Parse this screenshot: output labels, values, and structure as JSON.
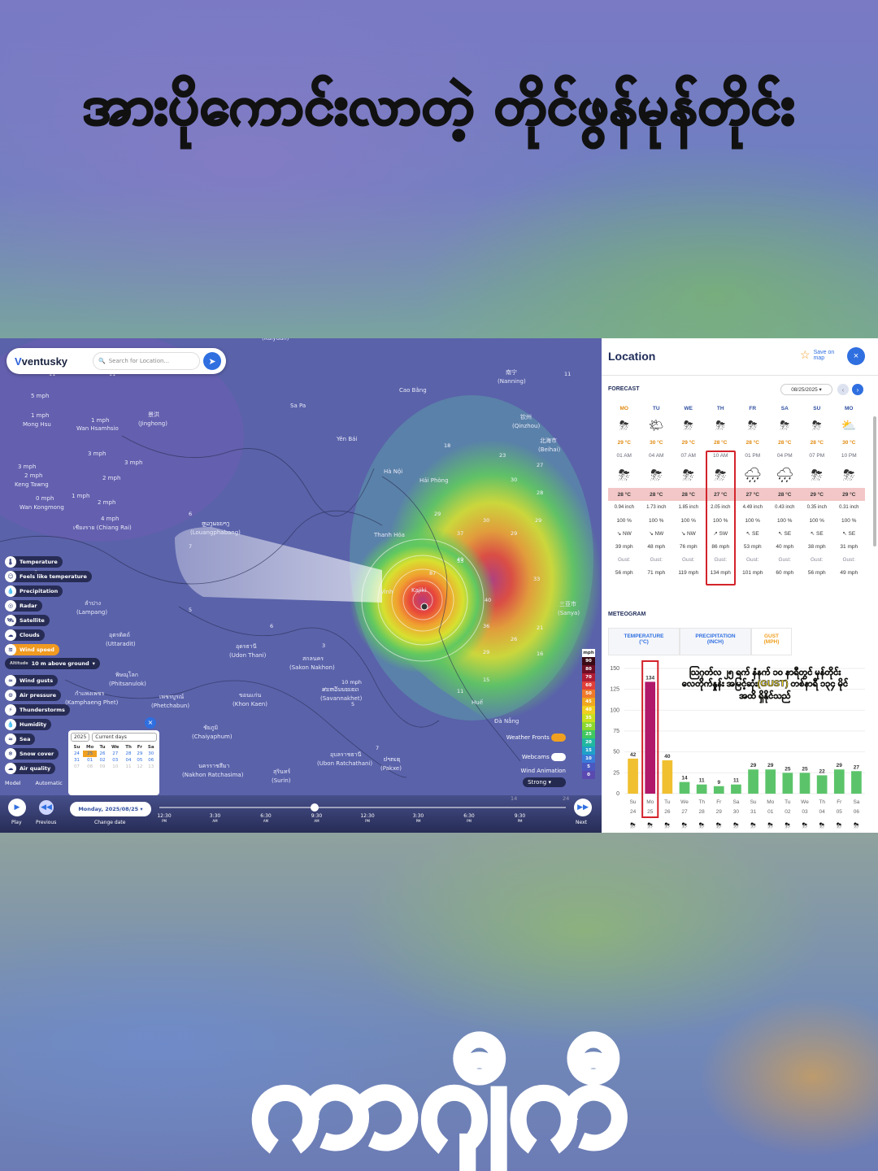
{
  "overlay": {
    "title": "အားပိုကောင်းလာတဲ့ တိုင်ဖွန်မုန်တိုင်း",
    "bottom_word": "ကာဂျီကီ"
  },
  "app": {
    "logo": "ventusky",
    "search_placeholder": "Search for Location..."
  },
  "map_labels": [
    {
      "text": "5 mph",
      "x": 38,
      "y": 73
    },
    {
      "text": "1 mph",
      "x": 38,
      "y": 97
    },
    {
      "text": "Mong Hsu",
      "x": 28,
      "y": 108
    },
    {
      "text": "1 mph",
      "x": 112,
      "y": 103
    },
    {
      "text": "Wan Hsamhsio",
      "x": 94,
      "y": 113
    },
    {
      "text": "景洪",
      "x": 182,
      "y": 96
    },
    {
      "text": "(Jinghong)",
      "x": 170,
      "y": 107
    },
    {
      "text": "3 mph",
      "x": 108,
      "y": 144
    },
    {
      "text": "3 mph",
      "x": 153,
      "y": 155
    },
    {
      "text": "3 mph",
      "x": 22,
      "y": 160
    },
    {
      "text": "2 mph",
      "x": 30,
      "y": 171
    },
    {
      "text": "Keng Tawng",
      "x": 18,
      "y": 182
    },
    {
      "text": "2 mph",
      "x": 126,
      "y": 174
    },
    {
      "text": "2 mph",
      "x": 120,
      "y": 204
    },
    {
      "text": "1 mph",
      "x": 88,
      "y": 196
    },
    {
      "text": "0 mph",
      "x": 44,
      "y": 199
    },
    {
      "text": "Wan Kongmong",
      "x": 24,
      "y": 210
    },
    {
      "text": "4 mph",
      "x": 124,
      "y": 224
    },
    {
      "text": "เชียงราย (Chiang Rai)",
      "x": 90,
      "y": 235
    },
    {
      "text": "ຫຼວງພະບາງ",
      "x": 248,
      "y": 230
    },
    {
      "text": "(Louangphabang)",
      "x": 234,
      "y": 241
    },
    {
      "text": "Sa Pa",
      "x": 357,
      "y": 85
    },
    {
      "text": "Yên Bái",
      "x": 414,
      "y": 126
    },
    {
      "text": "Cao Bằng",
      "x": 491,
      "y": 66
    },
    {
      "text": "南宁",
      "x": 622,
      "y": 44
    },
    {
      "text": "(Nanning)",
      "x": 612,
      "y": 55
    },
    {
      "text": "钦州",
      "x": 640,
      "y": 99
    },
    {
      "text": "(Qinzhou)",
      "x": 630,
      "y": 110
    },
    {
      "text": "北海市",
      "x": 664,
      "y": 128
    },
    {
      "text": "(Beihai)",
      "x": 662,
      "y": 139
    },
    {
      "text": "Hà Nội",
      "x": 472,
      "y": 166
    },
    {
      "text": "Hải Phòng",
      "x": 516,
      "y": 177
    },
    {
      "text": "Thanh Hóa",
      "x": 460,
      "y": 244
    },
    {
      "text": "Vinh",
      "x": 468,
      "y": 314
    },
    {
      "text": "Kajiki",
      "x": 506,
      "y": 312
    },
    {
      "text": "ลำปาง",
      "x": 104,
      "y": 328
    },
    {
      "text": "(Lampang)",
      "x": 94,
      "y": 339
    },
    {
      "text": "อุตรดิตถ์",
      "x": 134,
      "y": 367
    },
    {
      "text": "(Uttaradit)",
      "x": 130,
      "y": 378
    },
    {
      "text": "อุดรธานี",
      "x": 290,
      "y": 381
    },
    {
      "text": "(Udon Thani)",
      "x": 282,
      "y": 392
    },
    {
      "text": "สกลนคร",
      "x": 372,
      "y": 396
    },
    {
      "text": "(Sakon Nakhon)",
      "x": 356,
      "y": 407
    },
    {
      "text": "พิษณุโลก",
      "x": 142,
      "y": 416
    },
    {
      "text": "(Phitsanulok)",
      "x": 134,
      "y": 427
    },
    {
      "text": "กำแพงเพชร",
      "x": 92,
      "y": 439
    },
    {
      "text": "(Kamphaeng Phet)",
      "x": 80,
      "y": 450
    },
    {
      "text": "เพชรบูรณ์",
      "x": 196,
      "y": 443
    },
    {
      "text": "(Phetchabun)",
      "x": 186,
      "y": 454
    },
    {
      "text": "ขอนแก่น",
      "x": 294,
      "y": 441
    },
    {
      "text": "(Khon Kaen)",
      "x": 286,
      "y": 452
    },
    {
      "text": "ສະຫວັນນະເຂດ",
      "x": 396,
      "y": 434
    },
    {
      "text": "(Savannakhet)",
      "x": 394,
      "y": 445
    },
    {
      "text": "Huế",
      "x": 580,
      "y": 450
    },
    {
      "text": "Đà Nẵng",
      "x": 608,
      "y": 473
    },
    {
      "text": "ชัยภูมิ",
      "x": 250,
      "y": 481
    },
    {
      "text": "(Chaiyaphum)",
      "x": 236,
      "y": 492
    },
    {
      "text": "อุบลราชธานี",
      "x": 406,
      "y": 514
    },
    {
      "text": "(Ubon Ratchathani)",
      "x": 390,
      "y": 525
    },
    {
      "text": "ປາກເຊ",
      "x": 472,
      "y": 520
    },
    {
      "text": "(Pakxe)",
      "x": 468,
      "y": 531
    },
    {
      "text": "นครราชสีมา",
      "x": 244,
      "y": 528
    },
    {
      "text": "(Nakhon Ratchasima)",
      "x": 224,
      "y": 539
    },
    {
      "text": "สุรินทร์",
      "x": 336,
      "y": 535
    },
    {
      "text": "(Surin)",
      "x": 334,
      "y": 546
    },
    {
      "text": "三亚市",
      "x": 688,
      "y": 329
    },
    {
      "text": "(Sanya)",
      "x": 686,
      "y": 340
    },
    {
      "text": "(Kalyuan)",
      "x": 322,
      "y": 2
    }
  ],
  "map_numbers": [
    {
      "t": "11",
      "x": 60,
      "y": 46
    },
    {
      "t": "11",
      "x": 134,
      "y": 46
    },
    {
      "t": "11",
      "x": 694,
      "y": 46
    },
    {
      "t": "18",
      "x": 546,
      "y": 134
    },
    {
      "t": "23",
      "x": 614,
      "y": 146
    },
    {
      "t": "27",
      "x": 660,
      "y": 158
    },
    {
      "t": "30",
      "x": 628,
      "y": 176
    },
    {
      "t": "28",
      "x": 660,
      "y": 192
    },
    {
      "t": "29",
      "x": 534,
      "y": 218
    },
    {
      "t": "30",
      "x": 594,
      "y": 226
    },
    {
      "t": "29",
      "x": 658,
      "y": 226
    },
    {
      "t": "37",
      "x": 562,
      "y": 242
    },
    {
      "t": "29",
      "x": 628,
      "y": 242
    },
    {
      "t": "53",
      "x": 562,
      "y": 276
    },
    {
      "t": "49",
      "x": 562,
      "y": 274
    },
    {
      "t": "87",
      "x": 528,
      "y": 291
    },
    {
      "t": "40",
      "x": 596,
      "y": 324
    },
    {
      "t": "33",
      "x": 656,
      "y": 298
    },
    {
      "t": "36",
      "x": 594,
      "y": 356
    },
    {
      "t": "29",
      "x": 594,
      "y": 388
    },
    {
      "t": "26",
      "x": 628,
      "y": 372
    },
    {
      "t": "21",
      "x": 660,
      "y": 358
    },
    {
      "t": "16",
      "x": 660,
      "y": 390
    },
    {
      "t": "15",
      "x": 594,
      "y": 422
    },
    {
      "t": "11",
      "x": 562,
      "y": 436
    },
    {
      "t": "10 mph",
      "x": 420,
      "y": 425
    },
    {
      "t": "8",
      "x": 42,
      "y": 290
    },
    {
      "t": "6",
      "x": 232,
      "y": 218
    },
    {
      "t": "7",
      "x": 232,
      "y": 258
    },
    {
      "t": "5",
      "x": 232,
      "y": 336
    },
    {
      "t": "6",
      "x": 332,
      "y": 356
    },
    {
      "t": "3",
      "x": 396,
      "y": 380
    },
    {
      "t": "5",
      "x": 432,
      "y": 452
    },
    {
      "t": "7",
      "x": 462,
      "y": 506
    },
    {
      "t": "14",
      "x": 628,
      "y": 568
    },
    {
      "t": "24",
      "x": 692,
      "y": 568
    }
  ],
  "layers": [
    {
      "label": "Temperature",
      "icon": "thermometer-icon",
      "glyph": "🌡",
      "active": false
    },
    {
      "label": "Feels like temperature",
      "icon": "feels-like-icon",
      "glyph": "☺",
      "active": false
    },
    {
      "label": "Precipitation",
      "icon": "raindrop-icon",
      "glyph": "💧",
      "active": false
    },
    {
      "label": "Radar",
      "icon": "radar-icon",
      "glyph": "◎",
      "active": false
    },
    {
      "label": "Satellite",
      "icon": "satellite-icon",
      "glyph": "🛰",
      "active": false
    },
    {
      "label": "Clouds",
      "icon": "cloud-icon",
      "glyph": "☁",
      "active": false
    },
    {
      "label": "Wind speed",
      "icon": "wind-icon",
      "glyph": "≋",
      "active": true
    },
    {
      "label": "Wind gusts",
      "icon": "wind-gust-icon",
      "glyph": "≈",
      "active": false
    },
    {
      "label": "Air pressure",
      "icon": "pressure-icon",
      "glyph": "⊙",
      "active": false
    },
    {
      "label": "Thunderstorms",
      "icon": "lightning-icon",
      "glyph": "⚡",
      "active": false
    },
    {
      "label": "Humidity",
      "icon": "humidity-icon",
      "glyph": "💧",
      "active": false
    },
    {
      "label": "Sea",
      "icon": "wave-icon",
      "glyph": "≈",
      "active": false
    },
    {
      "label": "Snow cover",
      "icon": "snowflake-icon",
      "glyph": "❄",
      "active": false
    },
    {
      "label": "Air quality",
      "icon": "air-quality-icon",
      "glyph": "☁",
      "active": false
    }
  ],
  "altitude": {
    "label": "Altitude",
    "value": "10 m above ground"
  },
  "model": {
    "label": "Model",
    "value": "Automatic"
  },
  "calendar": {
    "year": "2025",
    "mode": "Current days",
    "weekdays": [
      "Su",
      "Mo",
      "Tu",
      "We",
      "Th",
      "Fr",
      "Sa"
    ],
    "weeks": [
      [
        "24",
        "25",
        "26",
        "27",
        "28",
        "29",
        "30"
      ],
      [
        "31",
        "01",
        "02",
        "03",
        "04",
        "05",
        "06"
      ],
      [
        "07",
        "08",
        "09",
        "10",
        "11",
        "12",
        "13"
      ]
    ],
    "today": "25"
  },
  "timeline": {
    "date": "Monday, 2025/08/25",
    "change_date": "Change date",
    "play": "Play",
    "previous": "Previous",
    "next": "Next",
    "ticks": [
      {
        "t": "12:30",
        "p": "PM"
      },
      {
        "t": "3:30",
        "p": "AM"
      },
      {
        "t": "6:30",
        "p": "AM"
      },
      {
        "t": "9:30",
        "p": "AM"
      },
      {
        "t": "12:30",
        "p": "PM"
      },
      {
        "t": "3:30",
        "p": "PM"
      },
      {
        "t": "6:30",
        "p": "PM"
      },
      {
        "t": "9:30",
        "p": "PM"
      }
    ]
  },
  "wind_legend": {
    "unit": "mph",
    "steps": [
      {
        "v": "90",
        "c": "#3a0a14"
      },
      {
        "v": "80",
        "c": "#6e0e24"
      },
      {
        "v": "70",
        "c": "#b01c34"
      },
      {
        "v": "60",
        "c": "#e0403a"
      },
      {
        "v": "50",
        "c": "#f07a2a"
      },
      {
        "v": "45",
        "c": "#f0a820"
      },
      {
        "v": "40",
        "c": "#f0d020"
      },
      {
        "v": "35",
        "c": "#c8e020"
      },
      {
        "v": "30",
        "c": "#8cd830"
      },
      {
        "v": "25",
        "c": "#40c860"
      },
      {
        "v": "20",
        "c": "#20b8a0"
      },
      {
        "v": "15",
        "c": "#20a0c8"
      },
      {
        "v": "10",
        "c": "#3a7ad8"
      },
      {
        "v": "5",
        "c": "#4a58c0"
      },
      {
        "v": "0",
        "c": "#5a4ab0"
      }
    ]
  },
  "map_controls": {
    "weather_fronts": "Weather Fronts",
    "webcams": "Webcams",
    "wind_animation": "Wind Animation",
    "wind_animation_value": "Strong"
  },
  "panel": {
    "title": "Location",
    "save": "Save on map",
    "forecast_label": "FORECAST",
    "date": "08/25/2025",
    "days": [
      {
        "d": "MO",
        "icon": "storm-icon",
        "g": "⛈",
        "t": "29 °C"
      },
      {
        "d": "TU",
        "icon": "partly-sunny-icon",
        "g": "🌤",
        "t": "30 °C"
      },
      {
        "d": "WE",
        "icon": "storm-icon",
        "g": "⛈",
        "t": "29 °C"
      },
      {
        "d": "TH",
        "icon": "storm-icon",
        "g": "⛈",
        "t": "28 °C"
      },
      {
        "d": "FR",
        "icon": "storm-icon",
        "g": "⛈",
        "t": "28 °C"
      },
      {
        "d": "SA",
        "icon": "storm-icon",
        "g": "⛈",
        "t": "28 °C"
      },
      {
        "d": "SU",
        "icon": "storm-icon",
        "g": "⛈",
        "t": "28 °C"
      },
      {
        "d": "MO",
        "icon": "cloud-sun-icon",
        "g": "⛅",
        "t": "30 °C"
      }
    ],
    "hours": [
      {
        "h": "01 AM",
        "icon": "storm-icon",
        "g": "⛈",
        "t": "28 °C",
        "p": "0.94 inch",
        "pp": "100 %",
        "wd": "↘ NW",
        "ws": "39 mph",
        "gl": "Gust:",
        "gs": "56 mph"
      },
      {
        "h": "04 AM",
        "icon": "storm-icon",
        "g": "⛈",
        "t": "28 °C",
        "p": "1.73 inch",
        "pp": "100 %",
        "wd": "↘ NW",
        "ws": "48 mph",
        "gl": "Gust:",
        "gs": "71 mph"
      },
      {
        "h": "07 AM",
        "icon": "storm-icon",
        "g": "⛈",
        "t": "28 °C",
        "p": "1.85 inch",
        "pp": "100 %",
        "wd": "↘ NW",
        "ws": "76 mph",
        "gl": "Gust:",
        "gs": "119 mph"
      },
      {
        "h": "10 AM",
        "icon": "storm-icon",
        "g": "⛈",
        "t": "27 °C",
        "p": "2.05 inch",
        "pp": "100 %",
        "wd": "↗ SW",
        "ws": "86 mph",
        "gl": "Gust:",
        "gs": "134 mph"
      },
      {
        "h": "01 PM",
        "icon": "heavy-rain-icon",
        "g": "🌧",
        "t": "27 °C",
        "p": "4.49 inch",
        "pp": "100 %",
        "wd": "↖ SE",
        "ws": "53 mph",
        "gl": "Gust:",
        "gs": "101 mph"
      },
      {
        "h": "04 PM",
        "icon": "heavy-rain-icon",
        "g": "🌧",
        "t": "28 °C",
        "p": "0.43 inch",
        "pp": "100 %",
        "wd": "↖ SE",
        "ws": "40 mph",
        "gl": "Gust:",
        "gs": "60 mph"
      },
      {
        "h": "07 PM",
        "icon": "storm-icon",
        "g": "⛈",
        "t": "29 °C",
        "p": "0.35 inch",
        "pp": "100 %",
        "wd": "↖ SE",
        "ws": "38 mph",
        "gl": "Gust:",
        "gs": "56 mph"
      },
      {
        "h": "10 PM",
        "icon": "storm-icon",
        "g": "⛈",
        "t": "29 °C",
        "p": "0.31 inch",
        "pp": "100 %",
        "wd": "↖ SE",
        "ws": "31 mph",
        "gl": "Gust:",
        "gs": "49 mph"
      }
    ],
    "meteogram_label": "METEOGRAM",
    "tabs": [
      {
        "label": "TEMPERATURE",
        "unit": "(°C)"
      },
      {
        "label": "PRECIPITATION",
        "unit": "(INCH)"
      },
      {
        "label": "GUST",
        "unit": "(MPH)"
      }
    ],
    "annotation": "ဩဂုတ်လ ၂၅ ရက် နံနက် ၁၀ နာရီတွင် မုန်တိုင်းလေတိုက်နှုန်း အမြင့်ဆုံး(GUST) တစ်နာရီ ၁၃၄ မိုင်အထိ ရှိနိုင်သည်"
  },
  "chart_data": {
    "type": "bar",
    "title": "",
    "xlabel": "",
    "ylabel": "",
    "ylim": [
      0,
      150
    ],
    "yticks": [
      0,
      25,
      50,
      75,
      100,
      125,
      150
    ],
    "categories": [
      {
        "d": "Su",
        "n": "24"
      },
      {
        "d": "Mo",
        "n": "25"
      },
      {
        "d": "Tu",
        "n": "26"
      },
      {
        "d": "We",
        "n": "27"
      },
      {
        "d": "Th",
        "n": "28"
      },
      {
        "d": "Fr",
        "n": "29"
      },
      {
        "d": "Sa",
        "n": "30"
      },
      {
        "d": "Su",
        "n": "31"
      },
      {
        "d": "Mo",
        "n": "01"
      },
      {
        "d": "Tu",
        "n": "02"
      },
      {
        "d": "We",
        "n": "03"
      },
      {
        "d": "Th",
        "n": "04"
      },
      {
        "d": "Fr",
        "n": "05"
      },
      {
        "d": "Sa",
        "n": "06"
      }
    ],
    "values": [
      42,
      134,
      40,
      14,
      11,
      9,
      11,
      29,
      29,
      25,
      25,
      22,
      29,
      27
    ],
    "colors": [
      "#f0c030",
      "#b0186a",
      "#f0c030",
      "#5bc46a",
      "#5bc46a",
      "#5bc46a",
      "#5bc46a",
      "#5bc46a",
      "#5bc46a",
      "#5bc46a",
      "#5bc46a",
      "#5bc46a",
      "#5bc46a",
      "#5bc46a"
    ],
    "highlight_index": 1
  }
}
